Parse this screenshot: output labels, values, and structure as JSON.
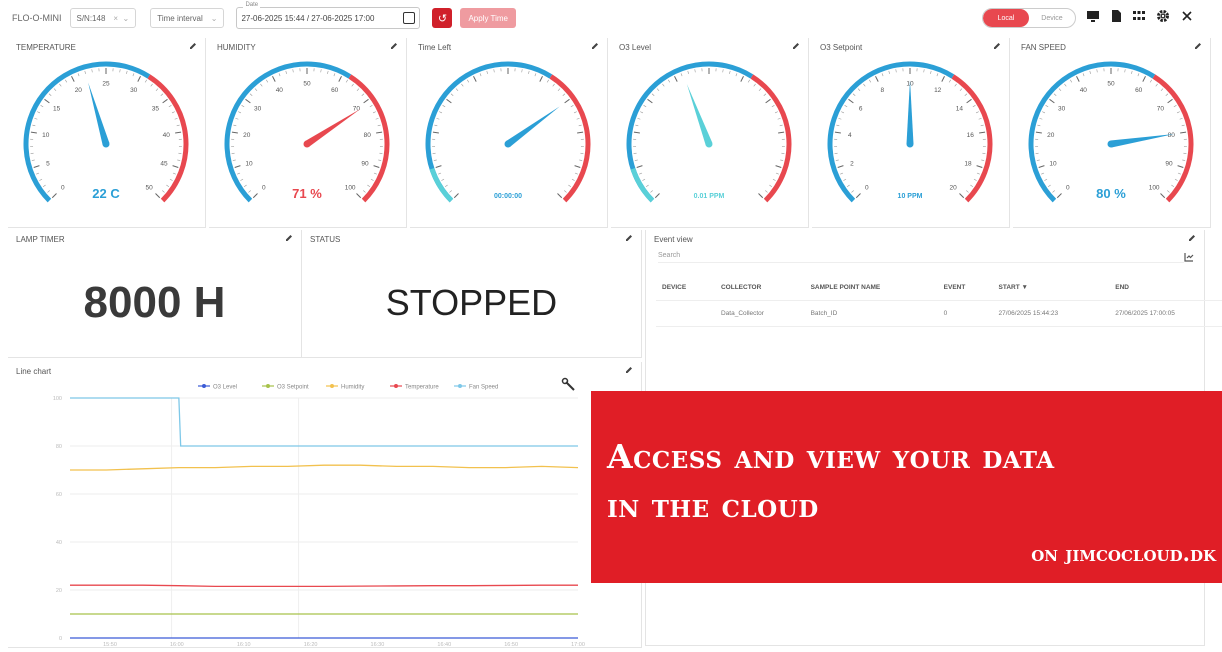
{
  "toolbar": {
    "device_name": "FLO-O-MINI",
    "serial": "S/N:148",
    "time_interval": "Time interval",
    "date_label": "Date",
    "date_range": "27-06-2025 15:44 / 27-06-2025 17:00",
    "apply_label": "Apply Time",
    "toggle_local": "Local",
    "toggle_device": "Device"
  },
  "gauges": [
    {
      "title": "TEMPERATURE",
      "min": 0,
      "max": 50,
      "value": 22,
      "display": "22 C",
      "ticks": [
        "0",
        "5",
        "10",
        "15",
        "20",
        "25",
        "30",
        "35",
        "40",
        "45",
        "50"
      ],
      "value_color": "#2b9fd6",
      "needle_color": "#2b9fd6"
    },
    {
      "title": "HUMIDITY",
      "min": 0,
      "max": 100,
      "value": 71,
      "display": "71 %",
      "ticks": [
        "0",
        "10",
        "20",
        "30",
        "40",
        "50",
        "60",
        "70",
        "80",
        "90",
        "100"
      ],
      "value_color": "#e8484f",
      "needle_color": "#e8484f"
    },
    {
      "title": "Time Left",
      "min": 0,
      "max": 100,
      "value": 70,
      "display": "00:00:00",
      "ticks": [
        "",
        "",
        "",
        "",
        "",
        "",
        "",
        "",
        "",
        "",
        ""
      ],
      "value_color": "#2b9fd6",
      "needle_color": "#2b9fd6"
    },
    {
      "title": "O3 Level",
      "min": 0,
      "max": 20,
      "value": 8.5,
      "display": "0.01 PPM",
      "ticks": [
        "",
        "",
        "",
        "",
        "",
        "",
        "",
        "",
        "",
        "",
        ""
      ],
      "value_color": "#5ad0d8",
      "needle_color": "#5ad0d8"
    },
    {
      "title": "O3 Setpoint",
      "min": 0,
      "max": 20,
      "value": 10,
      "display": "10 PPM",
      "ticks": [
        "0",
        "2",
        "4",
        "6",
        "8",
        "10",
        "12",
        "14",
        "16",
        "18",
        "20"
      ],
      "value_color": "#2b9fd6",
      "needle_color": "#2b9fd6"
    },
    {
      "title": "FAN SPEED",
      "min": 0,
      "max": 100,
      "value": 80,
      "display": "80 %",
      "ticks": [
        "0",
        "10",
        "20",
        "30",
        "40",
        "50",
        "60",
        "70",
        "80",
        "90",
        "100"
      ],
      "value_color": "#2b9fd6",
      "needle_color": "#2b9fd6"
    }
  ],
  "lamp": {
    "title": "LAMP TIMER",
    "value": "8000 H"
  },
  "status": {
    "title": "STATUS",
    "value": "STOPPED"
  },
  "events": {
    "title": "Event view",
    "search_placeholder": "Search",
    "columns": [
      "DEVICE",
      "COLLECTOR",
      "SAMPLE POINT NAME",
      "EVENT",
      "START ▼",
      "END"
    ],
    "rows": [
      [
        "",
        "Data_Collector",
        "Batch_ID",
        "0",
        "27/06/2025 15:44:23",
        "27/06/2025 17:00:05"
      ]
    ]
  },
  "chart_data": {
    "type": "line",
    "title": "Line chart",
    "legend": [
      "O3 Level",
      "O3 Setpoint",
      "Humidity",
      "Temperature",
      "Fan Speed"
    ],
    "legend_placement": "top",
    "colors": [
      "#3b5bd6",
      "#a7c24a",
      "#f2c14e",
      "#e8484f",
      "#7ec8e8"
    ],
    "y_ticks": [
      "0",
      "20",
      "40",
      "60",
      "80",
      "100"
    ],
    "ylim": [
      0,
      100
    ],
    "x_ticks": [
      "15:50",
      "16:00",
      "16:10",
      "16:20",
      "16:30",
      "16:40",
      "16:50",
      "17:00"
    ],
    "x": [
      0,
      1,
      2,
      3,
      4,
      5,
      6,
      7,
      8,
      9,
      10,
      11,
      12,
      13,
      14
    ],
    "series": [
      {
        "name": "O3 Level",
        "values": [
          0,
          0,
          0,
          0,
          0,
          0,
          0,
          0,
          0,
          0,
          0,
          0,
          0,
          0,
          0
        ]
      },
      {
        "name": "O3 Setpoint",
        "values": [
          10,
          10,
          10,
          10,
          10,
          10,
          10,
          10,
          10,
          10,
          10,
          10,
          10,
          10,
          10
        ]
      },
      {
        "name": "Humidity",
        "values": [
          70,
          70,
          70.5,
          71,
          71,
          71.5,
          71.5,
          72,
          72,
          71.5,
          71.5,
          71,
          71,
          71.5,
          71
        ]
      },
      {
        "name": "Temperature",
        "values": [
          22,
          22,
          22,
          21.8,
          21.5,
          21.5,
          21.5,
          21.5,
          21.6,
          21.7,
          21.8,
          21.8,
          21.9,
          22,
          22
        ]
      },
      {
        "name": "Fan Speed",
        "values": [
          100,
          100,
          100,
          100,
          80,
          80,
          80,
          80,
          80,
          80,
          80,
          80,
          80,
          80,
          80
        ]
      }
    ],
    "grid": true
  },
  "banner": {
    "line1": "Access and view your data",
    "line2": "in the cloud",
    "line3": "on jimcocloud.dk"
  }
}
